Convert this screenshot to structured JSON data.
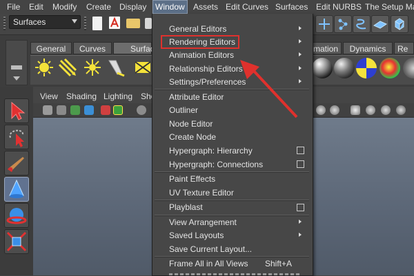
{
  "menubar": {
    "items": [
      "File",
      "Edit",
      "Modify",
      "Create",
      "Display",
      "Window",
      "Assets",
      "Edit Curves",
      "Surfaces",
      "Edit NURBS",
      "The Setup Mac"
    ]
  },
  "statusline": {
    "menuset_value": "Surfaces"
  },
  "shelf": {
    "tabs": [
      "General",
      "Curves",
      "Surfac",
      "mation",
      "Dynamics",
      "Re"
    ]
  },
  "panel": {
    "menus": [
      "View",
      "Shading",
      "Lighting",
      "Sho"
    ]
  },
  "window_menu": {
    "items": [
      {
        "label": "General Editors",
        "submenu": true
      },
      {
        "label": "Rendering Editors",
        "submenu": true
      },
      {
        "label": "Animation Editors",
        "submenu": true
      },
      {
        "label": "Relationship Editors",
        "submenu": true
      },
      {
        "label": "Settings/Preferences",
        "submenu": true
      },
      {
        "label": "Attribute Editor"
      },
      {
        "label": "Outliner"
      },
      {
        "label": "Node Editor"
      },
      {
        "label": "Create Node"
      },
      {
        "label": "Hypergraph: Hierarchy",
        "option_box": true
      },
      {
        "label": "Hypergraph: Connections",
        "option_box": true
      },
      {
        "label": "Paint Effects"
      },
      {
        "label": "UV Texture Editor"
      },
      {
        "label": "Playblast",
        "option_box": true
      },
      {
        "label": "View Arrangement",
        "submenu": true
      },
      {
        "label": "Saved Layouts",
        "submenu": true
      },
      {
        "label": "Save Current Layout..."
      },
      {
        "label": "Frame All in All Views",
        "shortcut": "Shift+A"
      }
    ]
  },
  "colors": {
    "highlight_box": "#e0312d",
    "arrow": "#e0312d",
    "active_menu": "#5c6f87"
  }
}
